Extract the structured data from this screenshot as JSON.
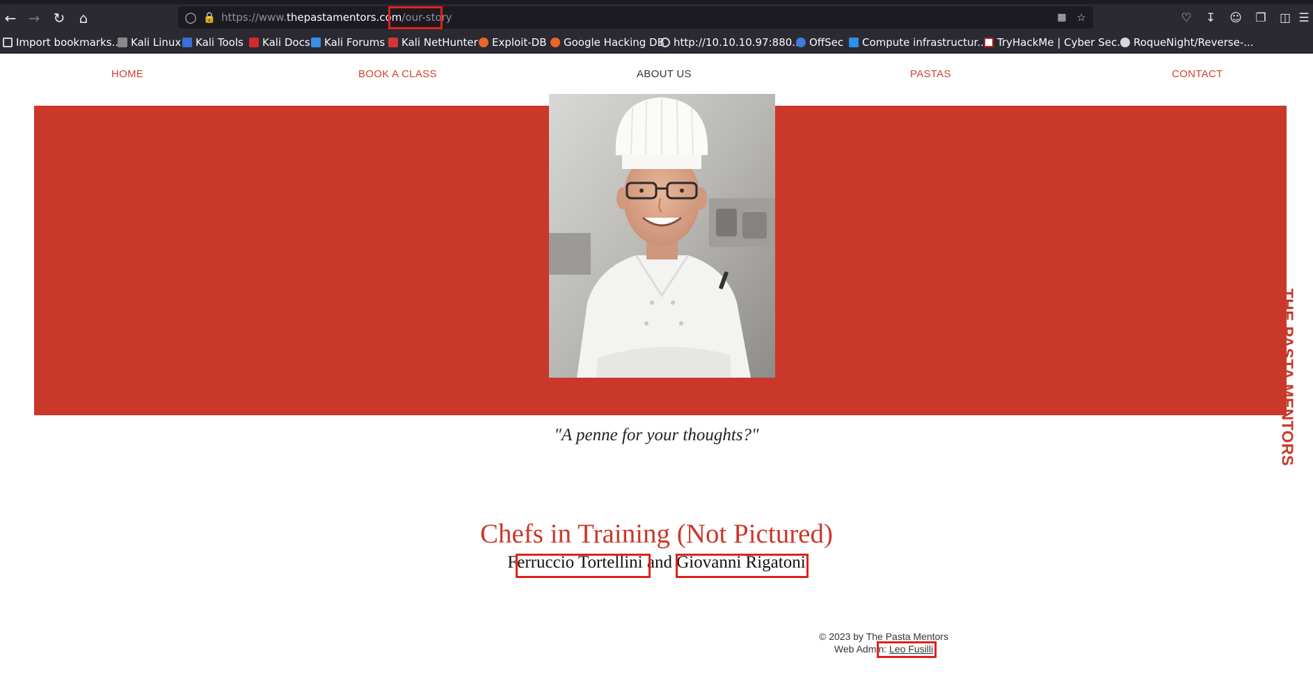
{
  "browser": {
    "url": {
      "protocol": "https://www.",
      "domain": "thepastamentors.com",
      "path": "/our-story"
    },
    "bookmarks": [
      {
        "label": "Import bookmarks...",
        "icon": "import-icon",
        "color": "#d7d7db"
      },
      {
        "label": "Kali Linux",
        "icon": "kali-dragon-icon",
        "color": "#c0c0c0"
      },
      {
        "label": "Kali Tools",
        "icon": "kali-tools-icon",
        "color": "#3a6fd8"
      },
      {
        "label": "Kali Docs",
        "icon": "kali-docs-icon",
        "color": "#d12b2b"
      },
      {
        "label": "Kali Forums",
        "icon": "kali-forums-icon",
        "color": "#3a8ee6"
      },
      {
        "label": "Kali NetHunter",
        "icon": "nethunter-icon",
        "color": "#d33636"
      },
      {
        "label": "Exploit-DB",
        "icon": "exploit-db-icon",
        "color": "#e8662a"
      },
      {
        "label": "Google Hacking DB",
        "icon": "ghdb-icon",
        "color": "#e8662a"
      },
      {
        "label": "http://10.10.10.97:880...",
        "icon": "globe-icon",
        "color": "#d7d7db"
      },
      {
        "label": "OffSec",
        "icon": "offsec-icon",
        "color": "#3b7de0"
      },
      {
        "label": "Compute infrastructur...",
        "icon": "azure-icon",
        "color": "#2c8fe8"
      },
      {
        "label": "TryHackMe | Cyber Sec...",
        "icon": "tryhackme-icon",
        "color": "#c11f1f"
      },
      {
        "label": "RoqueNight/Reverse-...",
        "icon": "github-icon",
        "color": "#d7d7db"
      }
    ]
  },
  "nav": {
    "home": "HOME",
    "book": "BOOK A CLASS",
    "about": "ABOUT US",
    "pastas": "PASTAS",
    "contact": "CONTACT"
  },
  "side_brand": "THE PASTA MENTORS",
  "quote": "\"A penne for your thoughts?\"",
  "chefs": {
    "title": "Chefs in Training (Not Pictured)",
    "name1": "Ferruccio Tortellini",
    "connector": "and",
    "name2": "Giovanni Rigatoni"
  },
  "footer": {
    "copyright": "© 2023 by The Pasta Mentors",
    "admin_label": "Web Admin: ",
    "admin_name": "Leo Fusilli"
  },
  "colors": {
    "brand_red": "#c9382a",
    "nav_red": "#d2402e",
    "highlight": "#e0201c"
  }
}
